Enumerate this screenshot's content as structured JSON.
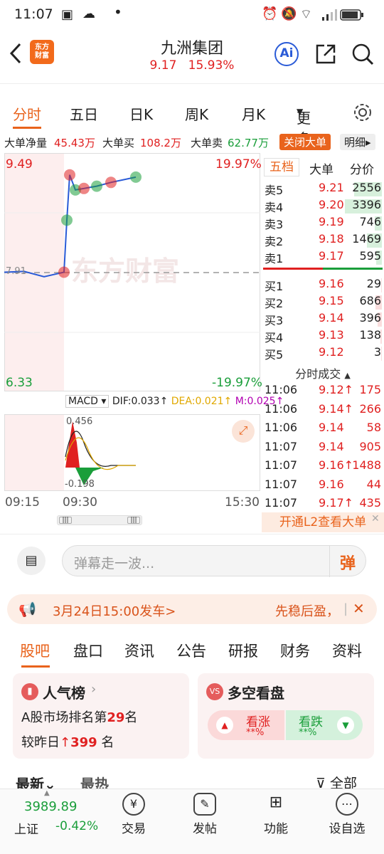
{
  "status_bar": {
    "time": "11:07",
    "dot": "•"
  },
  "header": {
    "back_icon": "chevron-left-icon",
    "logo_text_line1": "东方",
    "logo_text_line2": "财富",
    "title": "九洲集团",
    "price": "9.17",
    "change_pct": "15.93%",
    "ai_label": "Ai",
    "share_icon": "share-icon",
    "search_icon": "search-icon"
  },
  "period_tabs": [
    "分时",
    "五日",
    "日K",
    "周K",
    "月K",
    "更多"
  ],
  "settings_icon": "gear-icon",
  "info_bar": {
    "net_label": "大单净量",
    "net_value": "45.43万",
    "buy_label": "大单买",
    "buy_value": "108.2万",
    "sell_label": "大单卖",
    "sell_value": "62.77万",
    "close_big_label": "关闭大单",
    "detail_label": "明细"
  },
  "chart": {
    "price_high": "9.49",
    "price_low": "6.33",
    "pct_high": "19.97%",
    "pct_low": "-19.97%",
    "ref_label": "7.91",
    "watermark": "东方财富",
    "macd_selector": "MACD",
    "dif": "DIF:0.033",
    "dea": "DEA:0.021",
    "m": "M:0.025",
    "macd_high": "0.456",
    "macd_low": "-0.198",
    "time_labels": [
      "09:15",
      "09:30",
      "15:30"
    ]
  },
  "chart_data": {
    "type": "line",
    "title": "",
    "xlabel": "",
    "ylabel": "",
    "x": [
      "09:15",
      "09:20",
      "09:25",
      "09:30",
      "09:31",
      "09:35",
      "09:45",
      "10:00",
      "10:20",
      "10:40",
      "11:07"
    ],
    "series": [
      {
        "values": [
          7.91,
          7.92,
          7.85,
          7.91,
          8.6,
          9.2,
          9.0,
          9.02,
          9.05,
          9.1,
          9.17
        ]
      }
    ],
    "ylim": [
      6.33,
      9.49
    ]
  },
  "book_tabs": [
    "五档",
    "大单",
    "分价"
  ],
  "asks": [
    {
      "label": "卖5",
      "price": "9.21",
      "vol": "2556",
      "bar": 0.75
    },
    {
      "label": "卖4",
      "price": "9.20",
      "vol": "3396",
      "bar": 1.0
    },
    {
      "label": "卖3",
      "price": "9.19",
      "vol": "746",
      "bar": 0.2
    },
    {
      "label": "卖2",
      "price": "9.18",
      "vol": "1469",
      "bar": 0.4
    },
    {
      "label": "卖1",
      "price": "9.17",
      "vol": "595",
      "bar": 0.16
    }
  ],
  "bids": [
    {
      "label": "买1",
      "price": "9.16",
      "vol": "29",
      "bar": 0.02
    },
    {
      "label": "买2",
      "price": "9.15",
      "vol": "686",
      "bar": 0.18
    },
    {
      "label": "买3",
      "price": "9.14",
      "vol": "396",
      "bar": 0.11
    },
    {
      "label": "买4",
      "price": "9.13",
      "vol": "138",
      "bar": 0.04
    },
    {
      "label": "买5",
      "price": "9.12",
      "vol": "3",
      "bar": 0.01
    }
  ],
  "trades_title": "分时成交",
  "trades": [
    {
      "time": "11:06",
      "price": "9.12",
      "arrow": "↑",
      "vol": "175"
    },
    {
      "time": "11:06",
      "price": "9.14",
      "arrow": "↑",
      "vol": "266"
    },
    {
      "time": "11:06",
      "price": "9.14",
      "arrow": "",
      "vol": "58"
    },
    {
      "time": "11:07",
      "price": "9.14",
      "arrow": "",
      "vol": "905"
    },
    {
      "time": "11:07",
      "price": "9.16",
      "arrow": "↑",
      "vol": "1488"
    },
    {
      "time": "11:07",
      "price": "9.16",
      "arrow": "",
      "vol": "44"
    },
    {
      "time": "11:07",
      "price": "9.17",
      "arrow": "↑",
      "vol": "435"
    }
  ],
  "l2_promo": "开通L2查看大单",
  "comment": {
    "placeholder": "弹幕走一波...",
    "danmu_label": "弹"
  },
  "banner": {
    "left_text": "3月24日15:00发车>",
    "right_text": "先稳后盈，",
    "sep": "|"
  },
  "section_tabs": [
    "股吧",
    "盘口",
    "资讯",
    "公告",
    "研报",
    "财务",
    "资料"
  ],
  "popularity": {
    "title": "人气榜",
    "rank_prefix": "A股市场排名第",
    "rank": "29",
    "rank_suffix": "名",
    "change_prefix": "较昨日",
    "change_value": "399",
    "change_suffix": "名"
  },
  "bullbear": {
    "title": "多空看盘",
    "up_label": "看涨",
    "up_pct": "**%",
    "down_label": "看跌",
    "down_pct": "**%"
  },
  "feed_tabs": {
    "latest": "最新",
    "hot": "最热",
    "all": "全部"
  },
  "bottom_nav": {
    "index_value": "3989.89",
    "index_name": "上证",
    "index_change": "-0.42%",
    "items": [
      "交易",
      "发帖",
      "功能",
      "设自选"
    ]
  }
}
